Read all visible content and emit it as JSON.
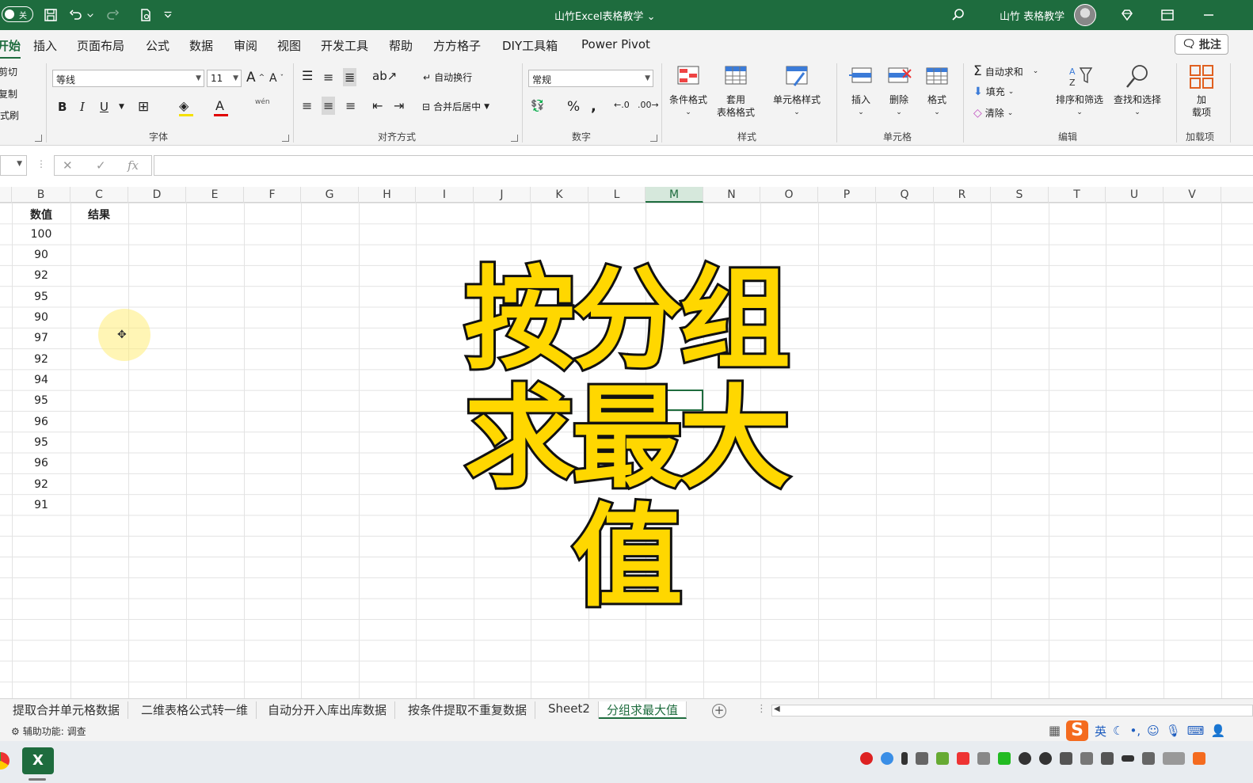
{
  "titlebar": {
    "autosave_state": "关",
    "doc_title": "山竹Excel表格教学 ⌄",
    "user_name": "山竹 表格教学"
  },
  "tabs": [
    {
      "label": "开始",
      "active": true
    },
    {
      "label": "插入"
    },
    {
      "label": "页面布局"
    },
    {
      "label": "公式"
    },
    {
      "label": "数据"
    },
    {
      "label": "审阅"
    },
    {
      "label": "视图"
    },
    {
      "label": "开发工具"
    },
    {
      "label": "帮助"
    },
    {
      "label": "方方格子"
    },
    {
      "label": "DIY工具箱"
    },
    {
      "label": "Power Pivot"
    }
  ],
  "comment_button": "批注",
  "ribbon": {
    "clipboard": {
      "cut": "剪切",
      "copy": "复制",
      "format_painter": "格式刷"
    },
    "font": {
      "name": "等线",
      "size": "11",
      "group_label": "字体",
      "phonetic": "wén"
    },
    "alignment": {
      "wrap": "自动换行",
      "merge": "合并后居中",
      "group_label": "对齐方式"
    },
    "number": {
      "format": "常规",
      "group_label": "数字"
    },
    "styles": {
      "conditional": "条件格式",
      "table_line1": "套用",
      "table_line2": "表格格式",
      "cell_styles": "单元格样式",
      "group_label": "样式"
    },
    "cells": {
      "insert": "插入",
      "delete": "删除",
      "format": "格式",
      "group_label": "单元格"
    },
    "editing": {
      "autosum": "自动求和",
      "fill": "填充",
      "clear": "清除",
      "sort_filter": "排序和筛选",
      "find_select": "查找和选择",
      "group_label": "编辑"
    },
    "addins": {
      "label_line1": "加",
      "label_line2": "载项",
      "group_label": "加载项"
    }
  },
  "formula_bar": {
    "fx": "fx"
  },
  "columns": [
    "B",
    "C",
    "D",
    "E",
    "F",
    "G",
    "H",
    "I",
    "J",
    "K",
    "L",
    "M",
    "N",
    "O",
    "P",
    "Q",
    "R",
    "S",
    "T",
    "U",
    "V"
  ],
  "selected_column": "M",
  "table": {
    "header_b": "数值",
    "header_c": "结果",
    "values": [
      "100",
      "90",
      "92",
      "95",
      "90",
      "97",
      "92",
      "94",
      "95",
      "96",
      "95",
      "96",
      "92",
      "91"
    ]
  },
  "overlay": {
    "line1": "按分组",
    "line2": "求最大值"
  },
  "sheets": [
    {
      "label": "提取合并单元格数据"
    },
    {
      "label": "二维表格公式转一维"
    },
    {
      "label": "自动分开入库出库数据"
    },
    {
      "label": "按条件提取不重复数据"
    },
    {
      "label": "Sheet2"
    },
    {
      "label": "分组求最大值",
      "active": true
    }
  ],
  "status": {
    "accessibility": "辅助功能: 调查"
  },
  "ime": {
    "lang": "英"
  },
  "colors": {
    "accent": "#1e6c3e",
    "overlay_fill": "#ffd700",
    "overlay_stroke": "#111111"
  }
}
